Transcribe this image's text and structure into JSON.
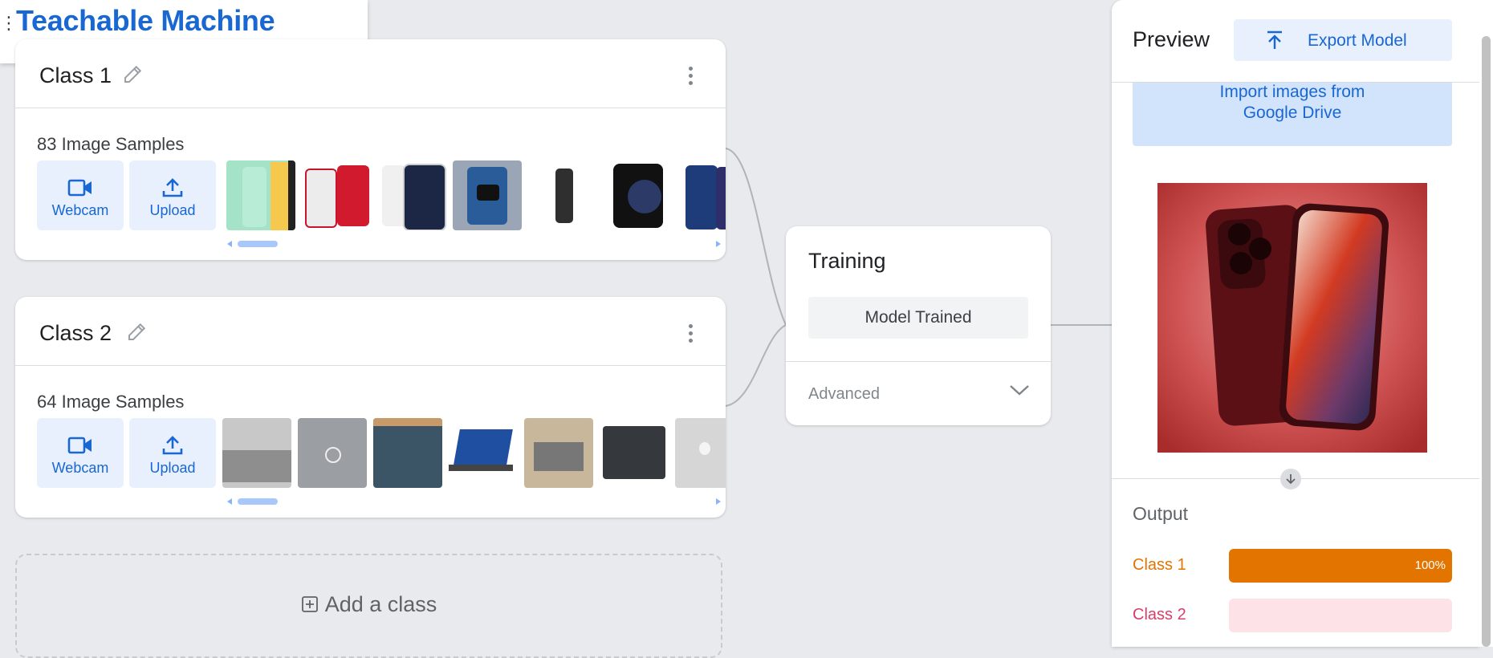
{
  "app": {
    "title": "Teachable Machine",
    "menu_icon": "menu-icon"
  },
  "classes": [
    {
      "name": "Class 1",
      "samples_text": "83 Image Samples",
      "webcam_label": "Webcam",
      "upload_label": "Upload",
      "thumbnails": [
        "green-iphone",
        "red-iphone-8",
        "white-iphone-14-pro",
        "blue-iphone-on-bed",
        "black-iphone-standing",
        "black-iphone-12",
        "blue-iphone-12"
      ]
    },
    {
      "name": "Class 2",
      "samples_text": "64 Image Samples",
      "webcam_label": "Webcam",
      "upload_label": "Upload",
      "thumbnails": [
        "silver-laptop-keyboard",
        "dell-laptop-lid",
        "dark-laptop-lid",
        "windows-laptop",
        "laptop-on-wood",
        "black-laptop",
        "macbook-lid"
      ]
    }
  ],
  "add_class": {
    "label": "Add a class"
  },
  "training": {
    "title": "Training",
    "status_button": "Model Trained",
    "advanced_label": "Advanced"
  },
  "preview": {
    "title": "Preview",
    "export_label": "Export Model",
    "drive_line1": "Import images from",
    "drive_line2": "Google Drive",
    "image": "red-iphone-14-pro",
    "output_title": "Output",
    "outputs": [
      {
        "label": "Class 1",
        "percent_text": "100%",
        "value": 1.0,
        "color": "#e37400",
        "bg": "#e37400"
      },
      {
        "label": "Class 2",
        "percent_text": "",
        "value": 0.0,
        "color": "#d93d6a",
        "bg": "#fde2e7"
      }
    ]
  },
  "colors": {
    "accent": "#1967d2",
    "accent_light": "#e8f0fe",
    "background": "#e8eaed"
  }
}
